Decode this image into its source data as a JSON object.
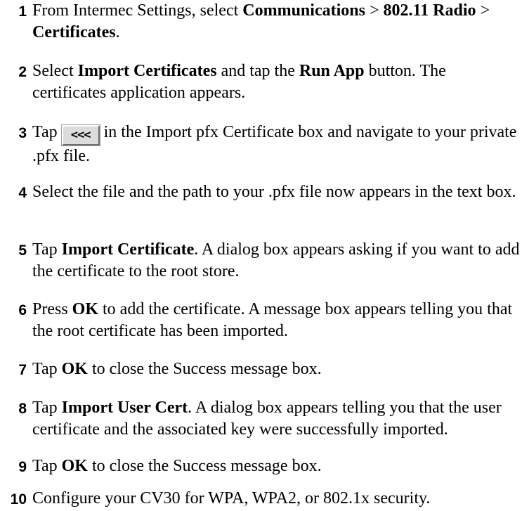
{
  "steps": [
    {
      "number": "1",
      "parts": [
        {
          "t": "From Intermec Settings, select "
        },
        {
          "t": "Communications",
          "b": true
        },
        {
          "t": " > "
        },
        {
          "t": "802.11 Radio",
          "b": true
        },
        {
          "t": " > "
        },
        {
          "t": "Certificates",
          "b": true
        },
        {
          "t": "."
        }
      ]
    },
    {
      "number": "2",
      "parts": [
        {
          "t": "Select "
        },
        {
          "t": "Import Certificates",
          "b": true
        },
        {
          "t": " and tap the "
        },
        {
          "t": "Run App",
          "b": true
        },
        {
          "t": " button. The certificates application appears."
        }
      ]
    },
    {
      "number": "3",
      "parts": [
        {
          "t": "Tap "
        },
        {
          "button": "<<<",
          "icon": "browse-button-icon"
        },
        {
          "t": " in the Import pfx Certificate box and navigate to your private .pfx file."
        }
      ]
    },
    {
      "number": "4",
      "parts": [
        {
          "t": "Select the file and the path to your .pfx file now appears in the text box."
        }
      ]
    },
    {
      "number": "5",
      "parts": [
        {
          "t": "Tap "
        },
        {
          "t": "Import Certificate",
          "b": true
        },
        {
          "t": ". A dialog box appears asking if you want to add the certificate to the root store."
        }
      ]
    },
    {
      "number": "6",
      "parts": [
        {
          "t": "Press "
        },
        {
          "t": "OK",
          "b": true
        },
        {
          "t": " to add the certificate. A message box appears telling you that the root certificate has been imported."
        }
      ]
    },
    {
      "number": "7",
      "parts": [
        {
          "t": "Tap "
        },
        {
          "t": "OK",
          "b": true
        },
        {
          "t": " to close the Success message box."
        }
      ]
    },
    {
      "number": "8",
      "parts": [
        {
          "t": "Tap "
        },
        {
          "t": "Import User Cert",
          "b": true
        },
        {
          "t": ". A dialog box appears telling you that the user certificate and the associated key were successfully imported."
        }
      ]
    },
    {
      "number": "9",
      "parts": [
        {
          "t": "Tap "
        },
        {
          "t": "OK",
          "b": true
        },
        {
          "t": " to close the Success message box."
        }
      ]
    },
    {
      "number": "10",
      "parts": [
        {
          "t": "Configure your CV30 for WPA, WPA2, or 802.1x security."
        }
      ]
    }
  ]
}
